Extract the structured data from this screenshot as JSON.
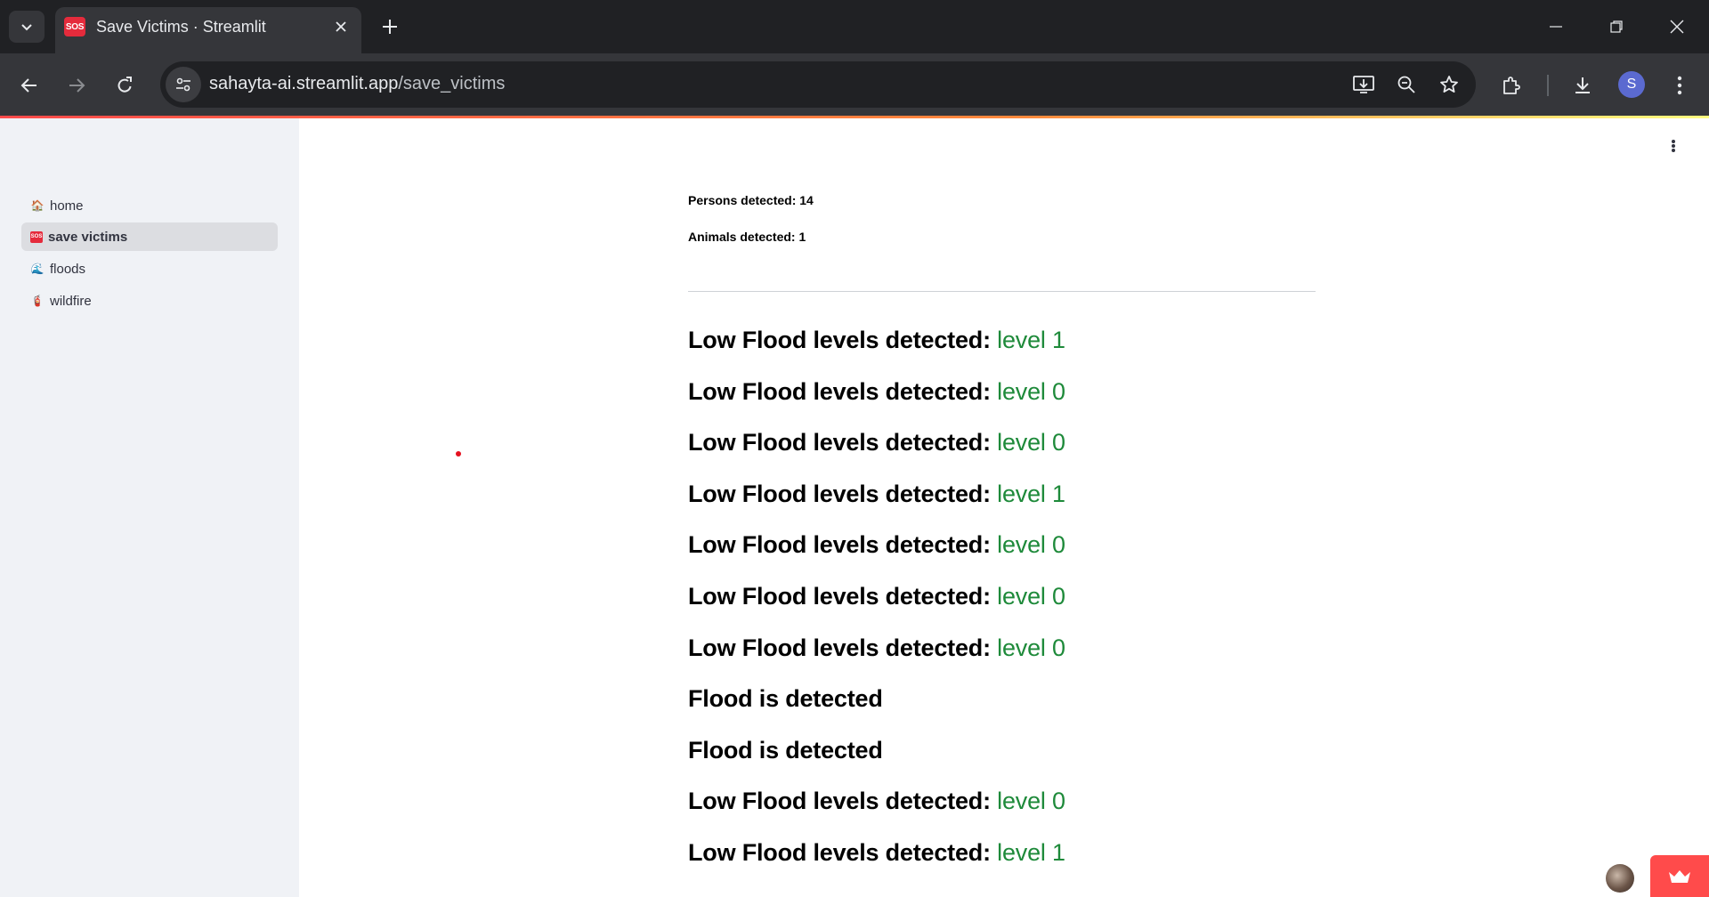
{
  "browser": {
    "tab_title": "Save Victims · Streamlit",
    "tab_favicon_text": "SOS",
    "url_host": "sahayta-ai.streamlit.app",
    "url_path": "/save_victims",
    "profile_initial": "S",
    "icons": [
      "tab-search-icon",
      "close-icon",
      "plus-icon",
      "minimize-icon",
      "restore-icon",
      "window-close-icon",
      "back-icon",
      "forward-icon",
      "reload-icon",
      "site-settings-icon",
      "install-app-icon",
      "zoom-icon",
      "bookmark-star-icon",
      "extensions-icon",
      "download-icon",
      "kebab-menu-icon"
    ]
  },
  "sidebar": {
    "items": [
      {
        "emoji": "🏠",
        "label": "home",
        "active": false
      },
      {
        "emoji": "SOS",
        "label": "save victims",
        "active": true
      },
      {
        "emoji": "🌊",
        "label": "floods",
        "active": false
      },
      {
        "emoji": "🧯",
        "label": "wildfire",
        "active": false
      }
    ]
  },
  "main": {
    "stats": [
      {
        "text": "Persons detected: 14"
      },
      {
        "text": "Animals detected: 1"
      }
    ],
    "results": [
      {
        "prefix": "Low Flood levels detected: ",
        "level": "level 1"
      },
      {
        "prefix": "Low Flood levels detected: ",
        "level": "level 0"
      },
      {
        "prefix": "Low Flood levels detected: ",
        "level": "level 0"
      },
      {
        "prefix": "Low Flood levels detected: ",
        "level": "level 1"
      },
      {
        "prefix": "Low Flood levels detected: ",
        "level": "level 0"
      },
      {
        "prefix": "Low Flood levels detected: ",
        "level": "level 0"
      },
      {
        "prefix": "Low Flood levels detected: ",
        "level": "level 0"
      },
      {
        "prefix": "Flood is detected",
        "level": ""
      },
      {
        "prefix": "Flood is detected",
        "level": ""
      },
      {
        "prefix": "Low Flood levels detected: ",
        "level": "level 0"
      },
      {
        "prefix": "Low Flood levels detected: ",
        "level": "level 1"
      }
    ]
  },
  "colors": {
    "level_text": "#1e8a3a",
    "accent": "#ff4b4b",
    "sidebar_bg": "#f0f2f6"
  }
}
